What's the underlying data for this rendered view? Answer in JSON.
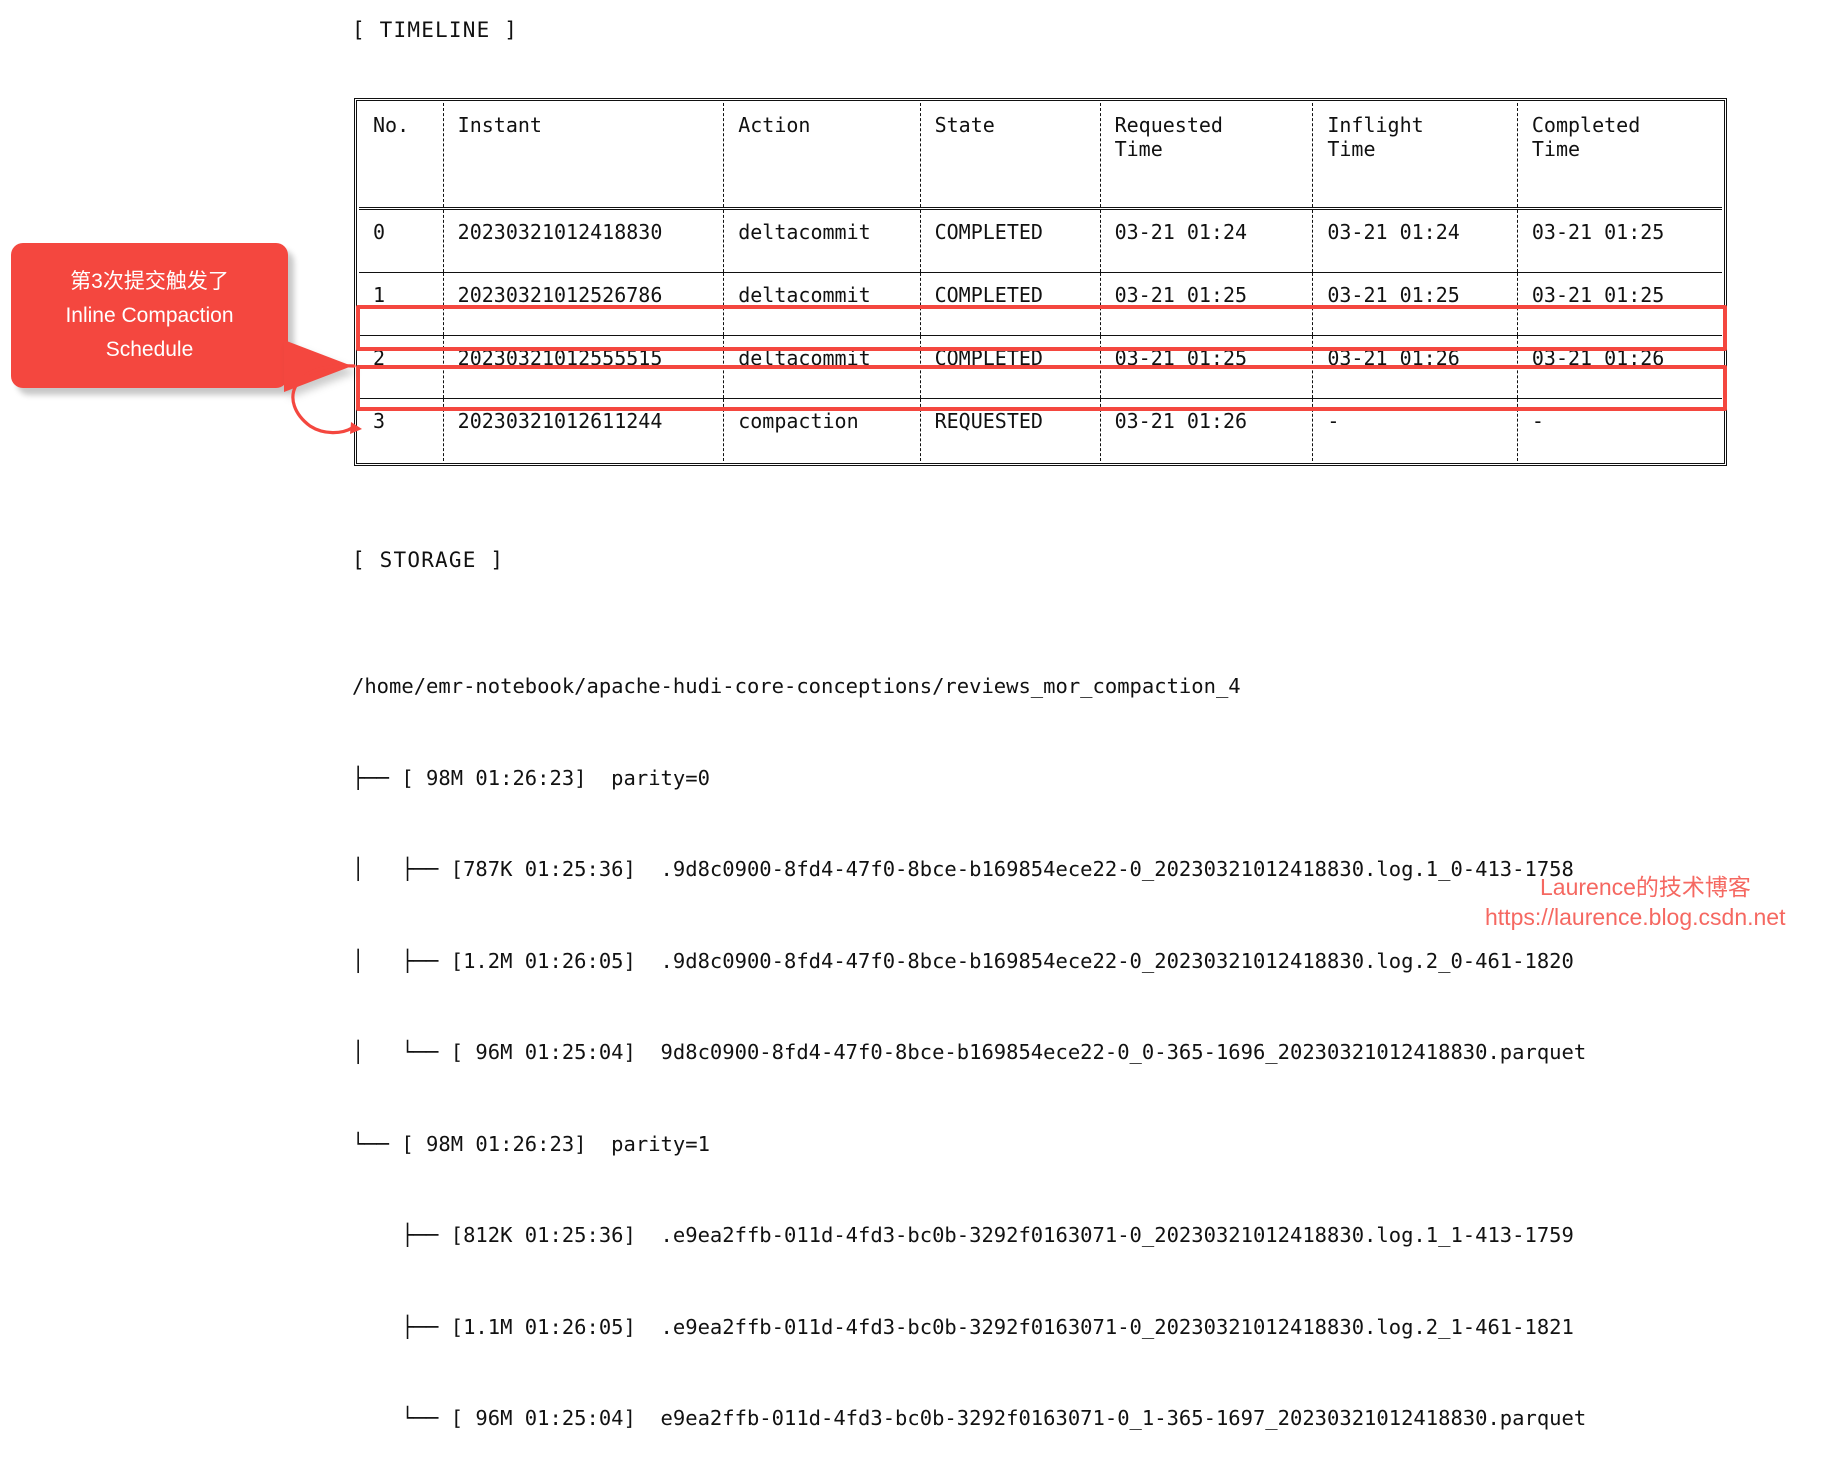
{
  "sections": {
    "timeline_label": "[ TIMELINE ]",
    "storage_label": "[ STORAGE ]"
  },
  "timeline": {
    "columns": [
      "No.",
      "Instant",
      "Action",
      "State",
      "Requested\nTime",
      "Inflight\nTime",
      "Completed\nTime"
    ],
    "rows": [
      {
        "no": "0",
        "instant": "20230321012418830",
        "action": "deltacommit",
        "state": "COMPLETED",
        "requested_time": "03-21 01:24",
        "inflight_time": "03-21 01:24",
        "completed_time": "03-21 01:25",
        "highlighted": false
      },
      {
        "no": "1",
        "instant": "20230321012526786",
        "action": "deltacommit",
        "state": "COMPLETED",
        "requested_time": "03-21 01:25",
        "inflight_time": "03-21 01:25",
        "completed_time": "03-21 01:25",
        "highlighted": false
      },
      {
        "no": "2",
        "instant": "20230321012555515",
        "action": "deltacommit",
        "state": "COMPLETED",
        "requested_time": "03-21 01:25",
        "inflight_time": "03-21 01:26",
        "completed_time": "03-21 01:26",
        "highlighted": true
      },
      {
        "no": "3",
        "instant": "20230321012611244",
        "action": "compaction",
        "state": "REQUESTED",
        "requested_time": "03-21 01:26",
        "inflight_time": "-",
        "completed_time": "-",
        "highlighted": true
      }
    ]
  },
  "callout": {
    "line1": "第3次提交触发了",
    "line2": "Inline Compaction",
    "line3": "Schedule",
    "color": "#f4473f"
  },
  "storage": {
    "root_path": "/home/emr-notebook/apache-hudi-core-conceptions/reviews_mor_compaction_4",
    "lines": [
      "├── [ 98M 01:26:23]  parity=0",
      "│   ├── [787K 01:25:36]  .9d8c0900-8fd4-47f0-8bce-b169854ece22-0_20230321012418830.log.1_0-413-1758",
      "│   ├── [1.2M 01:26:05]  .9d8c0900-8fd4-47f0-8bce-b169854ece22-0_20230321012418830.log.2_0-461-1820",
      "│   └── [ 96M 01:25:04]  9d8c0900-8fd4-47f0-8bce-b169854ece22-0_0-365-1696_20230321012418830.parquet",
      "└── [ 98M 01:26:23]  parity=1",
      "    ├── [812K 01:25:36]  .e9ea2ffb-011d-4fd3-bc0b-3292f0163071-0_20230321012418830.log.1_1-413-1759",
      "    ├── [1.1M 01:26:05]  .e9ea2ffb-011d-4fd3-bc0b-3292f0163071-0_20230321012418830.log.2_1-461-1821",
      "    └── [ 96M 01:25:04]  e9ea2ffb-011d-4fd3-bc0b-3292f0163071-0_1-365-1697_20230321012418830.parquet"
    ]
  },
  "watermark": {
    "line1": "Laurence的技术博客",
    "line2": "https://laurence.blog.csdn.net",
    "color": "#f4473f"
  }
}
